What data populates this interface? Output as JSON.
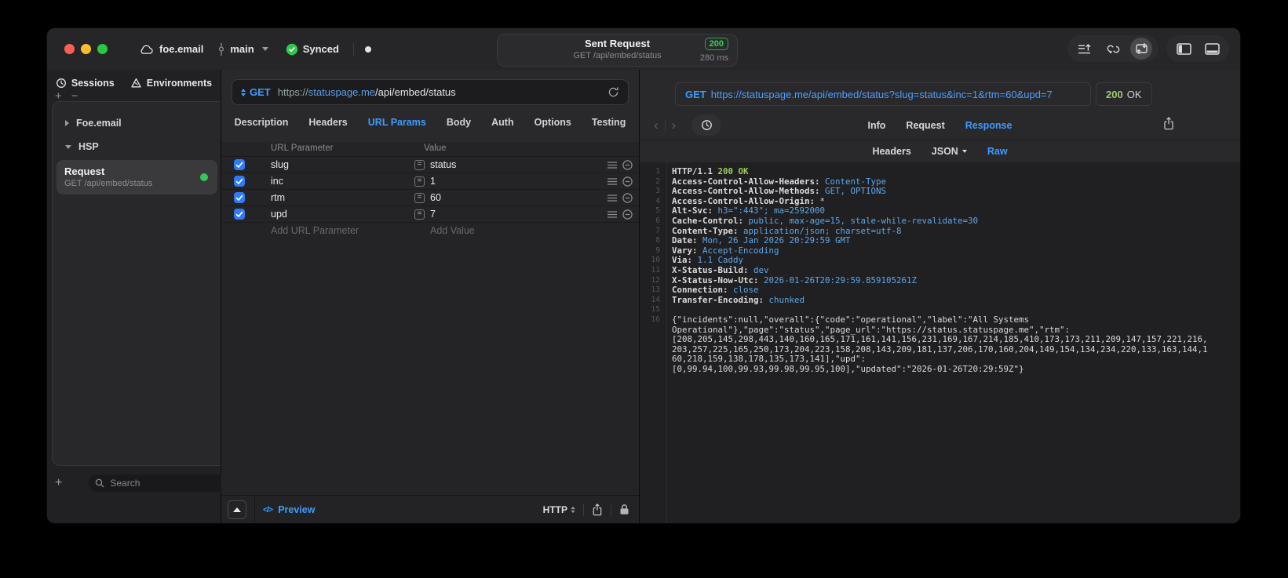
{
  "titlebar": {
    "project": "foe.email",
    "branch": "main",
    "sync_label": "Synced",
    "request_title": "Sent Request",
    "request_subtitle": "GET /api/embed/status",
    "status_code": "200",
    "duration": "280 ms"
  },
  "sidebar": {
    "tabs": [
      {
        "label": "Sessions",
        "icon": "history-icon",
        "active": true
      },
      {
        "label": "Environments",
        "icon": "environments-icon"
      }
    ],
    "groups": [
      {
        "label": "Foe.email",
        "state": "collapsed"
      },
      {
        "label": "HSP",
        "state": "expanded"
      }
    ],
    "request_item": {
      "title": "Request",
      "subtitle": "GET /api/embed/status",
      "selected": true
    },
    "search_placeholder": "Search"
  },
  "editor": {
    "method": "GET",
    "url": {
      "scheme": "https://",
      "host": "statuspage.me",
      "path": "/api/embed/status"
    },
    "tabs": [
      {
        "label": "Description"
      },
      {
        "label": "Headers"
      },
      {
        "label": "URL Params",
        "active": true
      },
      {
        "label": "Body"
      },
      {
        "label": "Auth"
      },
      {
        "label": "Options"
      },
      {
        "label": "Testing"
      }
    ],
    "params": {
      "columns": {
        "name": "URL Parameter",
        "value": "Value"
      },
      "rows": [
        {
          "name": "slug",
          "value": "status",
          "enabled": true
        },
        {
          "name": "inc",
          "value": "1",
          "enabled": true
        },
        {
          "name": "rtm",
          "value": "60",
          "enabled": true
        },
        {
          "name": "upd",
          "value": "7",
          "enabled": true
        }
      ],
      "add_name_placeholder": "Add URL Parameter",
      "add_value_placeholder": "Add Value"
    },
    "bottom_bar": {
      "preview_label": "Preview",
      "protocol": "HTTP"
    }
  },
  "response": {
    "method": "GET",
    "url": "https://statuspage.me/api/embed/status?slug=status&inc=1&rtm=60&upd=7",
    "status_code": "200",
    "status_text": "OK",
    "tabs": [
      {
        "label": "Info"
      },
      {
        "label": "Request"
      },
      {
        "label": "Response",
        "active": true
      }
    ],
    "subtabs": [
      {
        "label": "Headers"
      },
      {
        "label": "JSON",
        "dropdown": true
      },
      {
        "label": "Raw",
        "active": true
      }
    ],
    "raw": {
      "status_line": {
        "protocol": "HTTP/1.1",
        "status": "200 OK"
      },
      "headers": [
        {
          "name": "Access-Control-Allow-Headers",
          "value": "Content-Type"
        },
        {
          "name": "Access-Control-Allow-Methods",
          "value": "GET, OPTIONS"
        },
        {
          "name": "Access-Control-Allow-Origin",
          "value": "*",
          "plain": true
        },
        {
          "name": "Alt-Svc",
          "value": "h3=\":443\"; ma=2592000"
        },
        {
          "name": "Cache-Control",
          "value": "public, max-age=15, stale-while-revalidate=30"
        },
        {
          "name": "Content-Type",
          "value": "application/json; charset=utf-8"
        },
        {
          "name": "Date",
          "value": "Mon, 26 Jan 2026 20:29:59 GMT"
        },
        {
          "name": "Vary",
          "value": "Accept-Encoding"
        },
        {
          "name": "Via",
          "value": "1.1 Caddy"
        },
        {
          "name": "X-Status-Build",
          "value": "dev"
        },
        {
          "name": "X-Status-Now-Utc",
          "value": "2026-01-26T20:29:59.859105261Z"
        },
        {
          "name": "Connection",
          "value": "close"
        },
        {
          "name": "Transfer-Encoding",
          "value": "chunked"
        }
      ],
      "body_lines": [
        "{\"incidents\":null,\"overall\":{\"code\":\"operational\",\"label\":\"All Systems",
        "Operational\"},\"page\":\"status\",\"page_url\":\"https://status.statuspage.me\",\"rtm\":",
        "[208,205,145,298,443,140,160,165,171,161,141,156,231,169,167,214,185,410,173,173,211,209,147,157,221,216,",
        "203,257,225,165,250,173,204,223,158,208,143,209,181,137,206,170,160,204,149,154,134,234,220,133,163,144,1",
        "60,218,159,138,178,135,173,141],\"upd\":",
        "[0,99.94,100,99.93,99.98,99.95,100],\"updated\":\"2026-01-26T20:29:59Z\"}"
      ]
    }
  },
  "colors": {
    "accent_blue": "#3E9BFF",
    "code_value_blue": "#5EA7E8",
    "success_green": "#32D74B",
    "code_green": "#9CCB5D",
    "checkbox_blue": "#2F7BF5"
  }
}
